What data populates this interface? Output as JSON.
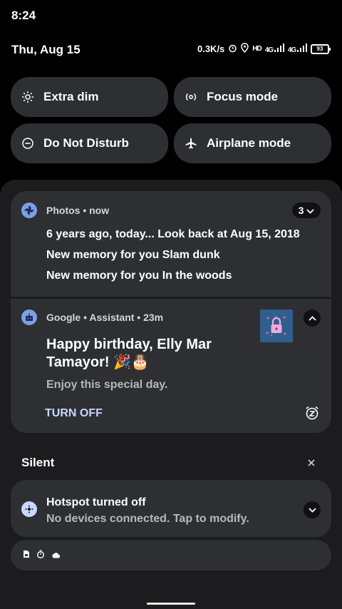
{
  "status": {
    "time": "8:24",
    "date": "Thu, Aug 15",
    "net_speed": "0.3K/s",
    "battery": "93",
    "net1": "4G",
    "net2": "4G"
  },
  "quick_settings": [
    {
      "label": "Extra dim",
      "icon": "brightness-icon"
    },
    {
      "label": "Focus mode",
      "icon": "focus-icon"
    },
    {
      "label": "Do Not Disturb",
      "icon": "dnd-icon"
    },
    {
      "label": "Airplane mode",
      "icon": "airplane-icon"
    }
  ],
  "notifications": {
    "photos": {
      "app": "Photos • now",
      "count": "3",
      "lines": [
        "6 years ago, today... Look back at Aug 15, 2018",
        "New memory for you Slam dunk",
        "New memory for you In the woods"
      ]
    },
    "assistant": {
      "app": "Google • Assistant • 23m",
      "title": "Happy birthday, Elly Mar Tamayor! 🎉🎂",
      "subtitle": "Enjoy this special day.",
      "action": "TURN OFF"
    }
  },
  "silent": {
    "header": "Silent",
    "hotspot": {
      "title": "Hotspot turned off",
      "subtitle": "No devices connected. Tap to modify."
    }
  }
}
